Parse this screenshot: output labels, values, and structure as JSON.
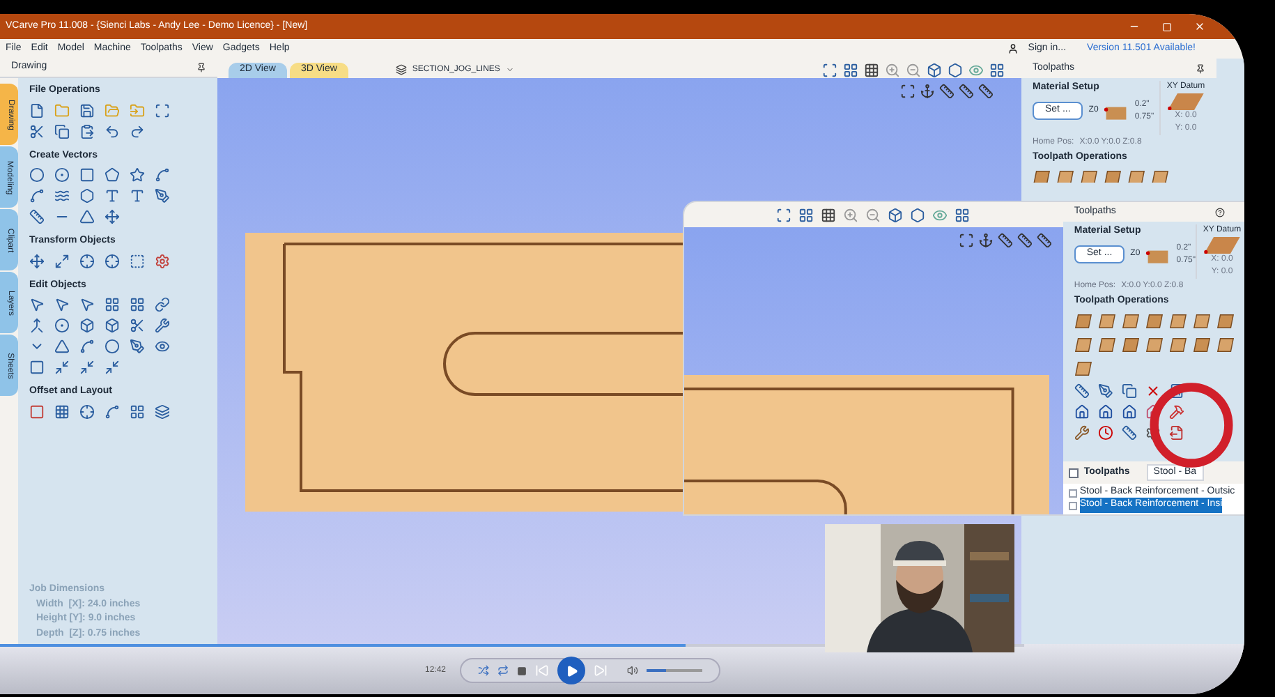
{
  "window": {
    "title": "VCarve Pro 11.008 - {Sienci Labs - Andy Lee - Demo Licence} - [New]"
  },
  "menu": [
    "File",
    "Edit",
    "Model",
    "Machine",
    "Toolpaths",
    "View",
    "Gadgets",
    "Help"
  ],
  "account": {
    "sign_in": "Sign in...",
    "update": "Version 11.501 Available!"
  },
  "drawing_panel": {
    "title": "Drawing",
    "side_tabs": [
      {
        "label": "Drawing",
        "selected": true
      },
      {
        "label": "Modeling",
        "selected": false
      },
      {
        "label": "Clipart",
        "selected": false
      },
      {
        "label": "Layers",
        "selected": false
      },
      {
        "label": "Sheets",
        "selected": false
      }
    ],
    "sections": [
      {
        "title": "File Operations"
      },
      {
        "title": "Create Vectors"
      },
      {
        "title": "Transform Objects"
      },
      {
        "title": "Edit Objects"
      },
      {
        "title": "Offset and Layout"
      }
    ],
    "job_dimensions": {
      "title": "Job Dimensions",
      "lines": [
        "Width  [X]: 24.0 inches",
        "Height [Y]: 9.0 inches",
        "Depth  [Z]: 0.75 inches"
      ]
    }
  },
  "view_tabs": [
    {
      "label": "2D View",
      "selected": false
    },
    {
      "label": "3D View",
      "selected": true
    }
  ],
  "layer": "SECTION_JOG_LINES",
  "toolpaths_panel": {
    "title": "Toolpaths",
    "material_setup": "Material Setup",
    "set_button": "Set ...",
    "z_label": "Z0",
    "dims": [
      "0.2\"",
      "0.75\""
    ],
    "xy_datum": "XY Datum",
    "x": "X: 0.0",
    "y": "Y: 0.0",
    "home": "Home Pos:",
    "home_value": "X:0.0 Y:0.0 Z:0.8",
    "operations": "Toolpath Operations"
  },
  "inset": {
    "title": "Toolpaths",
    "material_setup": "Material Setup",
    "set_button": "Set ...",
    "z_label": "Z0",
    "dims": [
      "0.2\"",
      "0.75\""
    ],
    "xy_datum": "XY Datum",
    "x": "X: 0.0",
    "y": "Y: 0.0",
    "home": "Home Pos:",
    "home_value": "X:0.0 Y:0.0 Z:0.8",
    "operations": "Toolpath Operations",
    "list_title": "Toolpaths",
    "list_checked": false,
    "list_filter": "Stool - Ba",
    "items": [
      {
        "label": "Stool  - Back Reinforcement - Outsic",
        "selected": false,
        "checked": false
      },
      {
        "label": "Stool - Back Reinforcement - Insi",
        "selected": true,
        "checked": false
      }
    ]
  },
  "player": {
    "time": "12:42",
    "level": 0.67,
    "volume": {
      "level": 0.35
    }
  }
}
